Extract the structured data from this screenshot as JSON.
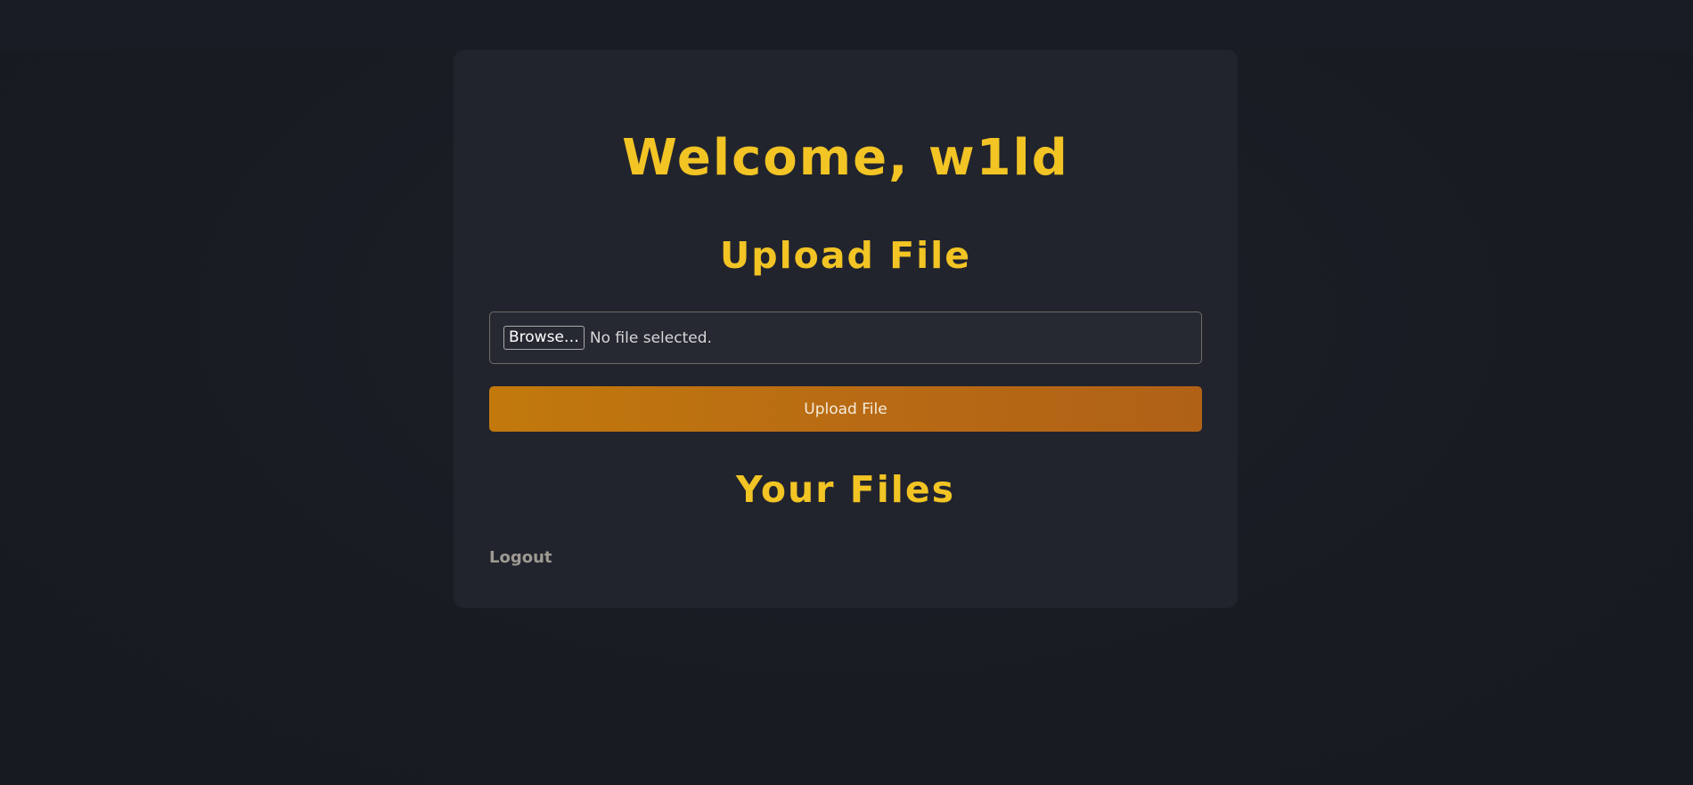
{
  "header": {
    "welcome_text": "Welcome, w1ld"
  },
  "upload": {
    "heading": "Upload File",
    "browse_label": "Browse…",
    "file_status": "No file selected.",
    "submit_label": "Upload File"
  },
  "files": {
    "heading": "Your Files"
  },
  "nav": {
    "logout_label": "Logout"
  },
  "colors": {
    "accent": "#f2c424",
    "button_gradient_start": "#c2790c",
    "button_gradient_end": "#b06116",
    "card_background": "#22242d",
    "page_background": "#181b22"
  }
}
